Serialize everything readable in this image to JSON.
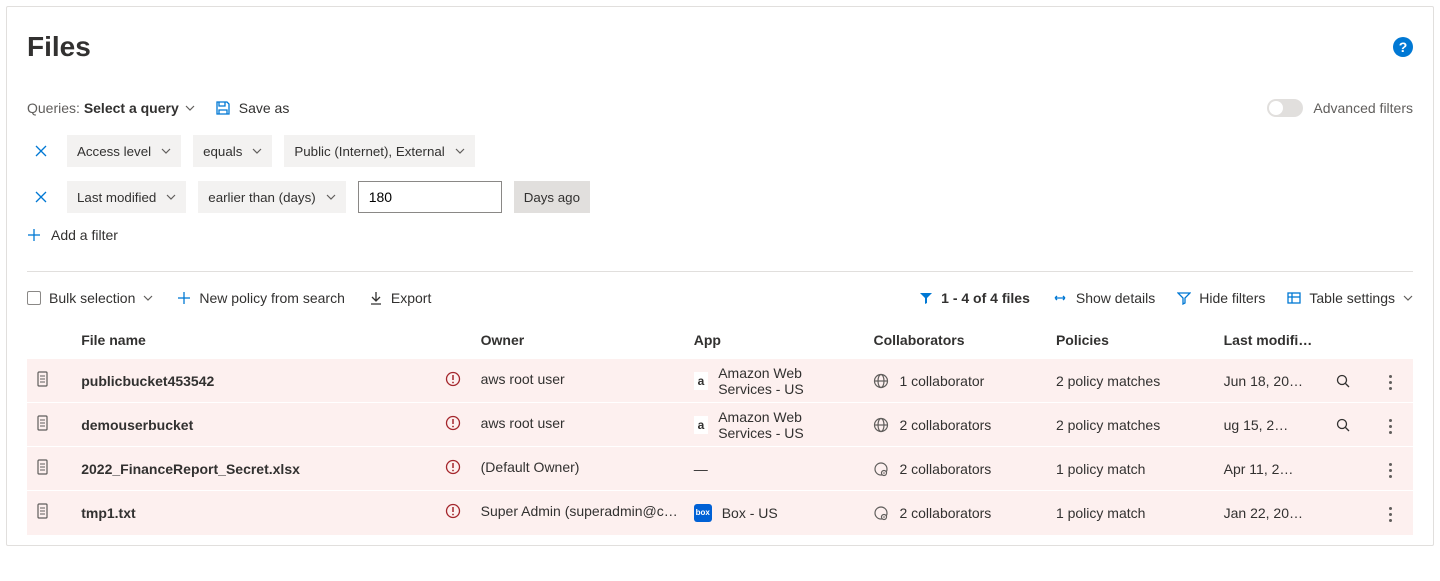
{
  "page_title": "Files",
  "queries_label": "Queries:",
  "queries_select": "Select a query",
  "save_as_label": "Save as",
  "advanced_filters_label": "Advanced filters",
  "filters": [
    {
      "field": "Access level",
      "op": "equals",
      "value": "Public (Internet), External",
      "value_type": "chip"
    },
    {
      "field": "Last modified",
      "op": "earlier than (days)",
      "value": "180",
      "value_type": "input",
      "unit": "Days ago"
    }
  ],
  "add_filter_label": "Add a filter",
  "actions": {
    "bulk_selection": "Bulk selection",
    "new_policy": "New policy from search",
    "export": "Export",
    "count_text": "1 - 4 of 4 files",
    "show_details": "Show details",
    "hide_filters": "Hide filters",
    "table_settings": "Table settings"
  },
  "columns": {
    "file_name": "File name",
    "owner": "Owner",
    "app": "App",
    "collaborators": "Collaborators",
    "policies": "Policies",
    "last_modified": "Last modifi…"
  },
  "rows": [
    {
      "name": "publicbucket453542",
      "owner": "aws root user",
      "app_icon": "a",
      "app": "Amazon Web Services - US",
      "collab_icon": "globe",
      "collab": "1 collaborator",
      "policies": "2 policy matches",
      "modified": "Jun 18, 20…",
      "search": true
    },
    {
      "name": "demouserbucket",
      "owner": "aws root user",
      "app_icon": "a",
      "app": "Amazon Web Services - US",
      "collab_icon": "globe",
      "collab": "2 collaborators",
      "policies": "2 policy matches",
      "modified": "ug 15, 2…",
      "search": true
    },
    {
      "name": "2022_FinanceReport_Secret.xlsx",
      "owner": "(Default Owner)",
      "app_icon": "",
      "app": "—",
      "collab_icon": "share",
      "collab": "2 collaborators",
      "policies": "1 policy match",
      "modified": "Apr 11, 2…",
      "search": false
    },
    {
      "name": "tmp1.txt",
      "owner": "Super Admin (superadmin@c…",
      "app_icon": "box",
      "app": "Box - US",
      "collab_icon": "share",
      "collab": "2 collaborators",
      "policies": "1 policy match",
      "modified": "Jan 22, 20…",
      "search": false
    }
  ]
}
